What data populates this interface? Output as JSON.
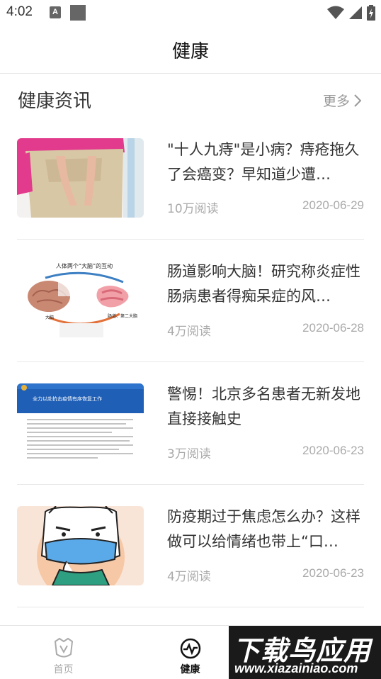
{
  "status_bar": {
    "time": "4:02",
    "notification_letter": "A"
  },
  "header": {
    "title": "健康"
  },
  "section": {
    "title": "健康资讯",
    "more_label": "更多"
  },
  "news": [
    {
      "title": "\"十人九痔\"是小病？痔疮拖久了会癌变？早知道少遭…",
      "views": "10万阅读",
      "date": "2020-06-29",
      "thumb": "back-pain-photo"
    },
    {
      "title": "肠道影响大脑！研究称炎症性肠病患者得痴呆症的风…",
      "views": "4万阅读",
      "date": "2020-06-28",
      "thumb": "brain-gut-diagram"
    },
    {
      "title": "警惕！北京多名患者无新发地直接接触史",
      "views": "3万阅读",
      "date": "2020-06-23",
      "thumb": "notice-document"
    },
    {
      "title": "防疫期过于焦虑怎么办？这样做可以给情绪也带上“口…",
      "views": "4万阅读",
      "date": "2020-06-23",
      "thumb": "masked-cartoon"
    }
  ],
  "thumb_texts": {
    "diagram_title": "人体两个“大脑”的互动",
    "brain_label": "大脑",
    "gut_label": "肠道、第二大脑",
    "doc_banner": "全力以赴抗击疫情有序恢复工作"
  },
  "bottom_nav": {
    "home_label": "首页",
    "health_label": "健康"
  },
  "watermark": {
    "title": "下载鸟应用",
    "url": "www.xiazainiao.com"
  },
  "colors": {
    "accent": "#111111",
    "muted": "#aaaaaa",
    "divider": "#e8e8e8"
  }
}
